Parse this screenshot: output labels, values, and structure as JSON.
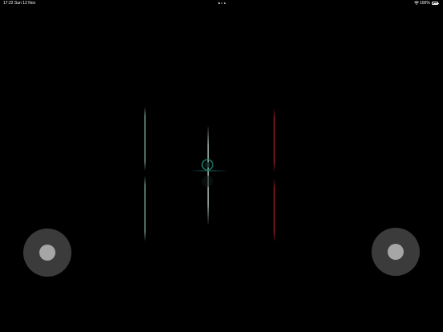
{
  "status_bar": {
    "time": "17:22",
    "date": "Sun 12 Nov",
    "battery_percent": "100%",
    "icons": [
      "multitask-dots-icon",
      "wifi-icon",
      "battery-icon"
    ]
  },
  "game": {
    "colors": {
      "background": "#000000",
      "left_line": "#9fd8c4",
      "center_line": "#d8f2e6",
      "right_line": "#b0202a",
      "target": "#1f7a6a",
      "joystick_base": "#3b3b3b",
      "joystick_knob": "#a6a6a6"
    },
    "joysticks": [
      "left-joystick",
      "right-joystick"
    ]
  }
}
